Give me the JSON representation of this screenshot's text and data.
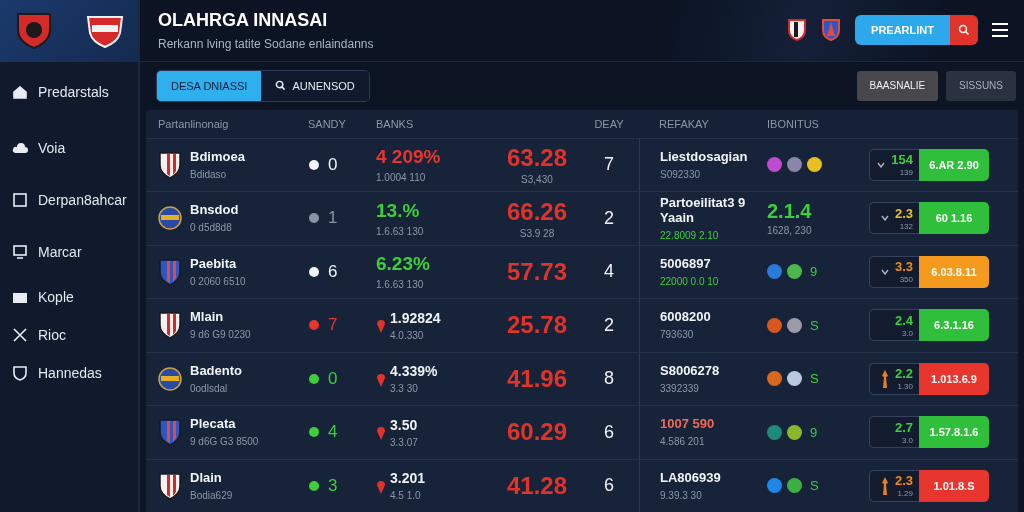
{
  "header": {
    "title": "OLAHRGA INNASAI",
    "subtitle": "Rerkann lving tatite Sodane enlaindanns",
    "action": "PREARLINT"
  },
  "sidebar": {
    "items": [
      {
        "label": "Predarstals",
        "selected": false
      },
      {
        "label": "Voia",
        "selected": false
      },
      {
        "label": "Derpan8ahcar",
        "selected": false
      },
      {
        "label": "Marcar",
        "selected": false
      },
      {
        "label": "Kople",
        "selected": false
      },
      {
        "label": "Rioc",
        "selected": false
      },
      {
        "label": "Hannedas",
        "selected": false
      }
    ]
  },
  "tabs": [
    {
      "label": "DESA DNIASSI",
      "selected": true
    },
    {
      "label": "AUNENSOD",
      "selected": false
    }
  ],
  "filters": [
    {
      "label": "BAASNALIE",
      "selected": true
    },
    {
      "label": "SISSUNS",
      "selected": false
    }
  ],
  "table": {
    "columns": [
      "Partanlinonaig",
      "SANDY",
      "BANKS",
      "DEAY",
      "REFAKAY",
      "IBONITUS"
    ],
    "rows": [
      {
        "name": "Bdimoea",
        "sub": "Bdidaso",
        "sandy": {
          "value": "0",
          "color": "#f0f2f6"
        },
        "pct": {
          "value": "4 209%",
          "sub": "1.0004 110",
          "color": "#e8352e",
          "pinned": false
        },
        "value": "63.28",
        "value_sub": "S3,430",
        "day": "7",
        "ref": "Liestdosagian",
        "ref_sub": "S092330",
        "ref_alert": false,
        "extra": {
          "kind": "dots",
          "dots": [
            {
              "color": "#c04ad0"
            },
            {
              "color": "#8a86a8"
            },
            {
              "color": "#e8c020"
            }
          ]
        },
        "odds": {
          "value": "154",
          "sub": "139",
          "color": "#3ccf3a"
        },
        "bet": "6.AR 2.90",
        "color": "#2fbf3a"
      },
      {
        "name": "Bnsdod",
        "sub": "0 d5d8d8",
        "sandy": {
          "value": "1",
          "color": "#8a93a6"
        },
        "pct": {
          "value": "13.%",
          "sub": "1.6.63 130",
          "color": "#3ccf3a",
          "pinned": false
        },
        "value": "66.26",
        "value_sub": "S3.9 28",
        "day": "2",
        "ref": "Partoeilitat3 9 Yaain",
        "ref_sub": "22.8009 2.10",
        "ref_alert": false,
        "extra": {
          "kind": "score",
          "score": "2.1.4",
          "score_sub": "1628, 230"
        },
        "odds": {
          "value": "2.3",
          "sub": "132",
          "color": "#e8c020"
        },
        "bet": "60 1.16",
        "color": "#2fbf3a"
      },
      {
        "name": "Paebita",
        "sub": "0 2060 6510",
        "sandy": {
          "value": "6",
          "color": "#f0f2f6"
        },
        "pct": {
          "value": "6.23%",
          "sub": "1.6.63 130",
          "color": "#3ccf3a",
          "pinned": false
        },
        "value": "57.73",
        "day": "4",
        "ref": "5006897",
        "ref_sub": "22000 0.0 10",
        "ref_alert": false,
        "extra": {
          "kind": "dots",
          "dots": [
            {
              "color": "#2a7ad8"
            },
            {
              "color": "#4ab84a"
            }
          ],
          "count": "9"
        },
        "odds": {
          "value": "3.3",
          "sub": "350",
          "color": "#f08a1c"
        },
        "bet": "6.03.8.11",
        "color": "#f59a1c"
      },
      {
        "name": "Mlain",
        "sub": "9 d6 G9 0230",
        "sandy": {
          "value": "7",
          "color": "#e8352e"
        },
        "pct": {
          "value": "1.92824",
          "sub": "4.0.330",
          "color": "#f0f2f6",
          "pinned": true
        },
        "value": "25.78",
        "day": "2",
        "ref": "6008200",
        "ref_sub": "793630",
        "ref_alert": false,
        "extra": {
          "kind": "dots",
          "dots": [
            {
              "color": "#d8581c"
            },
            {
              "color": "#9a9aa8"
            }
          ],
          "count": "S"
        },
        "odds": {
          "value": "2.4",
          "sub": "3.0",
          "color": "#3ccf3a"
        },
        "bet": "6.3.1.16",
        "color": "#2fbf3a"
      },
      {
        "name": "Badento",
        "sub": "0odlsdal",
        "sandy": {
          "value": "0",
          "color": "#3ccf3a"
        },
        "pct": {
          "value": "4.339%",
          "sub": "3.3 30",
          "color": "#f0f2f6",
          "pinned": true
        },
        "value": "41.96",
        "day": "8",
        "ref": "S8006278",
        "ref_sub": "3392339",
        "ref_alert": false,
        "extra": {
          "kind": "dots",
          "dots": [
            {
              "color": "#d8681c"
            },
            {
              "color": "#b8c8e0"
            }
          ],
          "count": "S"
        },
        "odds": {
          "value": "2.2",
          "sub": "1.30",
          "color": "#3ccf3a"
        },
        "bet": "1.013.6.9",
        "color": "#e8352e"
      },
      {
        "name": "Plecata",
        "sub": "9 d6G G3 8500",
        "sandy": {
          "value": "4",
          "color": "#3ccf3a"
        },
        "pct": {
          "value": "3.50",
          "sub": "3.3.07",
          "color": "#f0f2f6",
          "pinned": true
        },
        "value": "60.29",
        "day": "6",
        "ref": "1007 590",
        "ref_sub": "4.586 201",
        "ref_alert": true,
        "extra": {
          "kind": "dots",
          "dots": [
            {
              "color": "#1e8a78"
            },
            {
              "color": "#8ab82a"
            }
          ],
          "count": "9"
        },
        "odds": {
          "value": "2.7",
          "sub": "3.0",
          "color": "#3ccf3a"
        },
        "bet": "1.57.8.1.6",
        "color": "#2fbf3a"
      },
      {
        "name": "Dlain",
        "sub": "Bodia629",
        "sandy": {
          "value": "3",
          "color": "#3ccf3a"
        },
        "pct": {
          "value": "3.201",
          "sub": "4.5 1.0",
          "color": "#f0f2f6",
          "pinned": true
        },
        "value": "41.28",
        "day": "6",
        "ref": "LA806939",
        "ref_sub": "9.39.3 30",
        "ref_alert": false,
        "extra": {
          "kind": "dots",
          "dots": [
            {
              "color": "#1e88e8"
            },
            {
              "color": "#3ab040"
            }
          ],
          "count": "S"
        },
        "odds": {
          "value": "2.3",
          "sub": "1.29",
          "color": "#f08a1c"
        },
        "bet": "1.01.8.S",
        "color": "#e8352e"
      }
    ]
  }
}
